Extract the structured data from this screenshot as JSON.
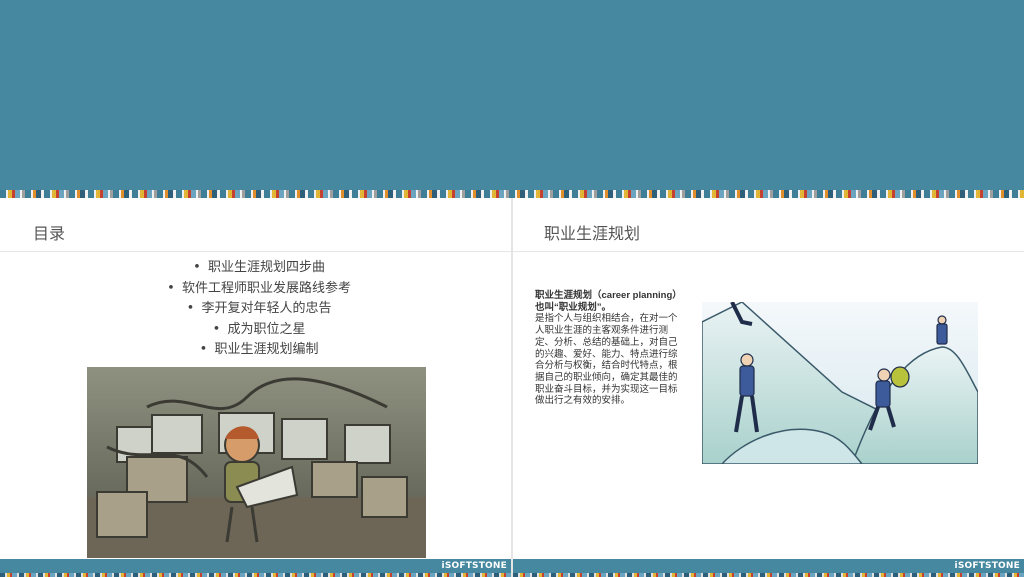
{
  "left_slide": {
    "title": "目录",
    "toc": [
      "职业生涯规划四步曲",
      "软件工程师职业发展路线参考",
      "李开复对年轻人的忠告",
      "成为职位之星",
      "职业生涯规划编制"
    ],
    "bullet": "•",
    "logo": "iSOFTSTONE"
  },
  "right_slide": {
    "title": "职业生涯规划",
    "intro": "职业生涯规划（career planning）也叫“职业规划”。",
    "body": "是指个人与组织相结合，在对一个人职业生涯的主客观条件进行测定、分析、总结的基础上，对自己的兴趣、爱好、能力、特点进行综合分析与权衡，结合时代特点，根据自己的职业倾向，确定其最佳的职业奋斗目标，并为实现这一目标做出行之有效的安排。",
    "logo": "iSOFTSTONE"
  },
  "colors": {
    "banner": "#45889f",
    "text": "#444444"
  },
  "icons": [
    "programmer-illustration",
    "mountain-climbers-illustration",
    "isoftstone-logo"
  ]
}
